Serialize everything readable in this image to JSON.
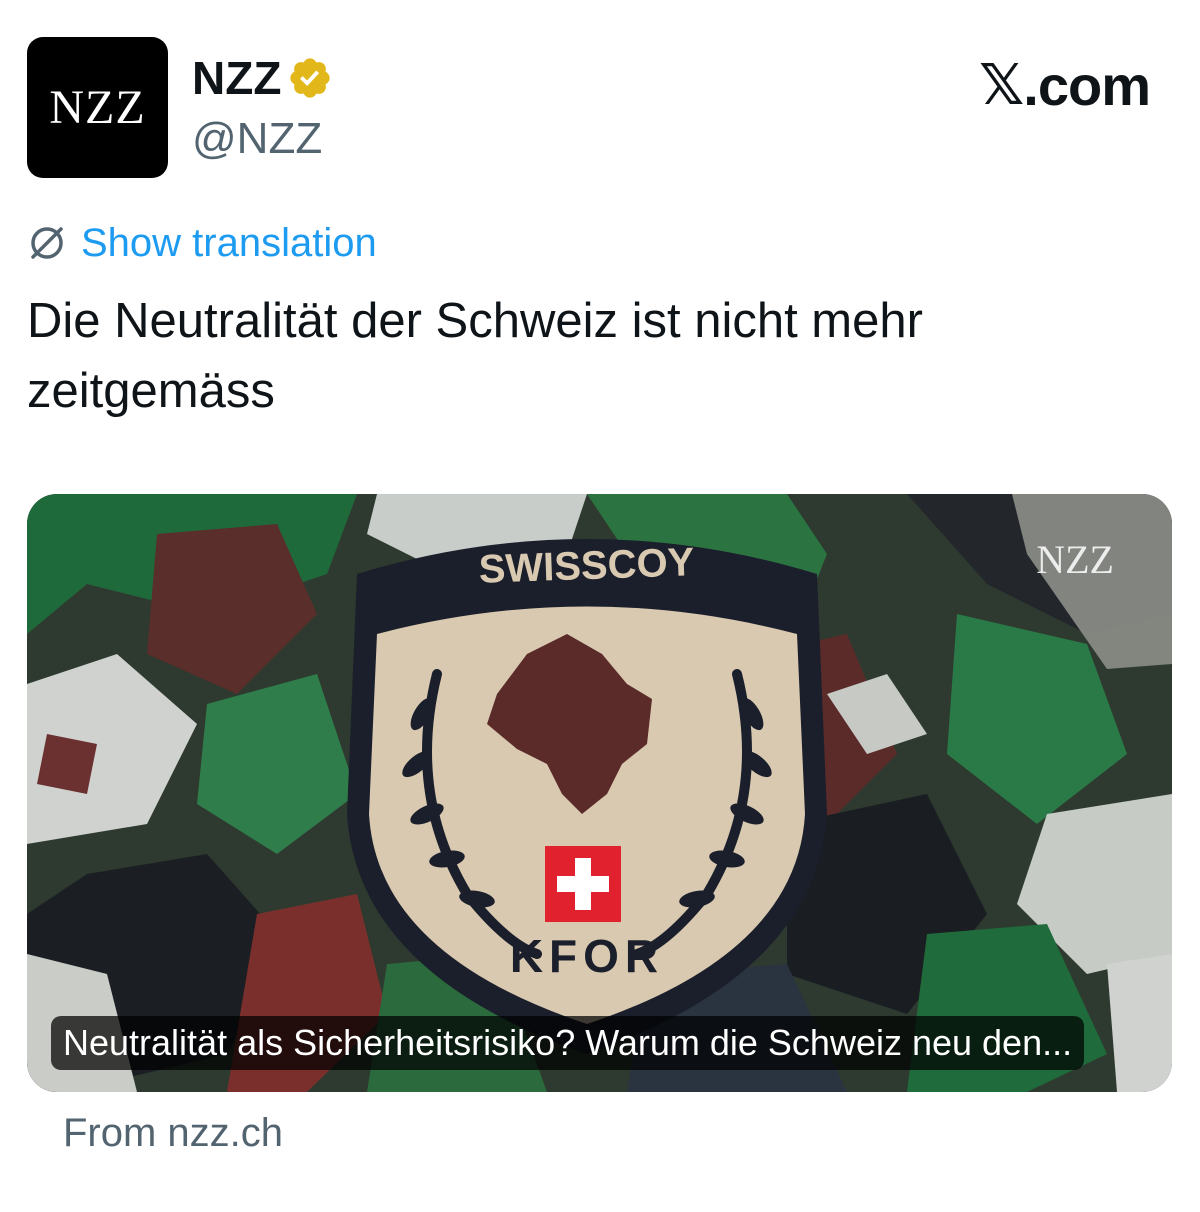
{
  "author": {
    "avatar_text": "NZZ",
    "display_name": "NZZ",
    "handle": "@NZZ",
    "verified_badge_icon": "verified-gold-badge-icon"
  },
  "brand": {
    "x_symbol": "𝕏",
    "domain_suffix": ".com"
  },
  "translation": {
    "icon": "globe-icon",
    "label": "Show translation"
  },
  "tweet": {
    "text": "Die Neutralität der Schweiz ist nicht mehr zeitgemäss"
  },
  "card": {
    "image_watermark": "NZZ",
    "patch_text_top": "SWISSCOY",
    "patch_text_bottom": "KFOR",
    "caption": "Neutralität als Sicherheitsrisiko? Warum die Schweiz neu den...",
    "source": "From nzz.ch"
  },
  "colors": {
    "link_blue": "#1d9bf0",
    "secondary_text": "#536471",
    "badge_gold": "#e2b719"
  }
}
